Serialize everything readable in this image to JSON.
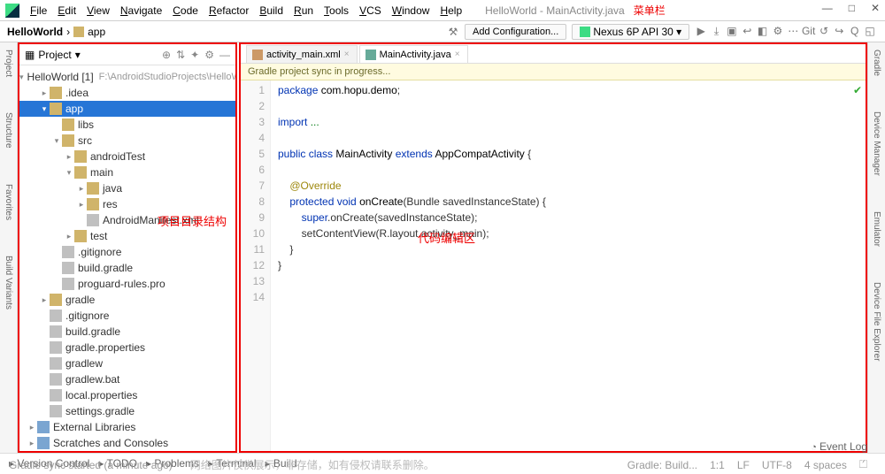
{
  "menu": {
    "items": [
      "File",
      "Edit",
      "View",
      "Navigate",
      "Code",
      "Refactor",
      "Build",
      "Run",
      "Tools",
      "VCS",
      "Window",
      "Help"
    ],
    "title": "HelloWorld - MainActivity.java",
    "annotation": "菜单栏"
  },
  "window_buttons": [
    "—",
    "□",
    "✕"
  ],
  "breadcrumb": [
    "HelloWorld",
    "app"
  ],
  "toolbar": {
    "add_config": "Add Configuration...",
    "device": "Nexus 6P API 30 ▾",
    "icons": [
      "▶",
      "⤓",
      "▣",
      "↩",
      "◧",
      "⚙",
      "⋯",
      "Git",
      "↺",
      "↪",
      "Q",
      "◱"
    ]
  },
  "project": {
    "title": "Project",
    "head_icons": [
      "⊕",
      "⇅",
      "✦",
      "⚙",
      "—"
    ],
    "annotation": "项目目录结构",
    "tree": [
      {
        "d": 0,
        "a": "v",
        "i": "mod",
        "t": "HelloWorld [1]",
        "suf": "F:\\AndroidStudioProjects\\HelloWorld"
      },
      {
        "d": 1,
        "a": ">",
        "i": "folder",
        "t": ".idea"
      },
      {
        "d": 1,
        "a": "v",
        "i": "folder",
        "t": "app",
        "sel": true
      },
      {
        "d": 2,
        "a": "",
        "i": "folder",
        "t": "libs"
      },
      {
        "d": 2,
        "a": "v",
        "i": "folder",
        "t": "src"
      },
      {
        "d": 3,
        "a": ">",
        "i": "folder",
        "t": "androidTest"
      },
      {
        "d": 3,
        "a": "v",
        "i": "folder",
        "t": "main"
      },
      {
        "d": 4,
        "a": ">",
        "i": "folder",
        "t": "java"
      },
      {
        "d": 4,
        "a": ">",
        "i": "folder",
        "t": "res"
      },
      {
        "d": 4,
        "a": "",
        "i": "file",
        "t": "AndroidManifest.xml"
      },
      {
        "d": 3,
        "a": ">",
        "i": "folder",
        "t": "test"
      },
      {
        "d": 2,
        "a": "",
        "i": "file",
        "t": ".gitignore"
      },
      {
        "d": 2,
        "a": "",
        "i": "file",
        "t": "build.gradle"
      },
      {
        "d": 2,
        "a": "",
        "i": "file",
        "t": "proguard-rules.pro"
      },
      {
        "d": 1,
        "a": ">",
        "i": "folder",
        "t": "gradle"
      },
      {
        "d": 1,
        "a": "",
        "i": "file",
        "t": ".gitignore"
      },
      {
        "d": 1,
        "a": "",
        "i": "file",
        "t": "build.gradle"
      },
      {
        "d": 1,
        "a": "",
        "i": "file",
        "t": "gradle.properties"
      },
      {
        "d": 1,
        "a": "",
        "i": "file",
        "t": "gradlew"
      },
      {
        "d": 1,
        "a": "",
        "i": "file",
        "t": "gradlew.bat"
      },
      {
        "d": 1,
        "a": "",
        "i": "file",
        "t": "local.properties"
      },
      {
        "d": 1,
        "a": "",
        "i": "file",
        "t": "settings.gradle"
      },
      {
        "d": 0,
        "a": ">",
        "i": "mod",
        "t": "External Libraries"
      },
      {
        "d": 0,
        "a": ">",
        "i": "mod",
        "t": "Scratches and Consoles"
      }
    ]
  },
  "leftrail": [
    "Project",
    "Structure",
    "Favorites",
    "Build Variants"
  ],
  "rightrail": [
    "Gradle",
    "Device Manager",
    "Emulator",
    "Device File Explorer"
  ],
  "tabs": [
    {
      "label": "activity_main.xml",
      "active": false
    },
    {
      "label": "MainActivity.java",
      "active": true
    }
  ],
  "banner": "Gradle project sync in progress...",
  "editor_annotation": "代码编辑区",
  "code": {
    "lines": [
      "1",
      "2",
      "3",
      "4",
      "5",
      "6",
      "7",
      "8",
      "9",
      "10",
      "11",
      "12",
      "13",
      "14"
    ],
    "tokens": [
      [
        [
          "kw",
          "package "
        ],
        [
          "cls",
          "com.hopu.demo"
        ],
        [
          "",
          ";"
        ]
      ],
      [],
      [
        [
          "kw",
          "import "
        ],
        [
          "str",
          "..."
        ]
      ],
      [],
      [
        [
          "kw",
          "public class "
        ],
        [
          "cls",
          "MainActivity "
        ],
        [
          "kw",
          "extends "
        ],
        [
          "cls",
          "AppCompatActivity "
        ],
        [
          "",
          "{"
        ]
      ],
      [],
      [
        [
          "",
          "    "
        ],
        [
          "at",
          "@Override"
        ]
      ],
      [
        [
          "",
          "    "
        ],
        [
          "kw",
          "protected void "
        ],
        [
          "cls",
          "onCreate"
        ],
        [
          "",
          "(Bundle savedInstanceState) {"
        ]
      ],
      [
        [
          "",
          "        "
        ],
        [
          "kw",
          "super"
        ],
        [
          "",
          ".onCreate(savedInstanceState);"
        ]
      ],
      [
        [
          "",
          "        setContentView(R.layout.activity_main);"
        ]
      ],
      [
        [
          "",
          "    }"
        ]
      ],
      [
        [
          "",
          "}"
        ]
      ],
      [],
      []
    ]
  },
  "status": {
    "tabs": [
      "Version Control",
      "TODO",
      "Problems",
      "Terminal",
      "Build"
    ],
    "msg": "Gradle sync started (a minute ago)",
    "watermark": "网络图片仅供展示，非存储，如有侵权请联系删除。",
    "right": [
      "Gradle: Build...",
      "1:1",
      "LF",
      "UTF-8",
      "4 spaces",
      "⏍"
    ],
    "event_log": "Event Log"
  }
}
